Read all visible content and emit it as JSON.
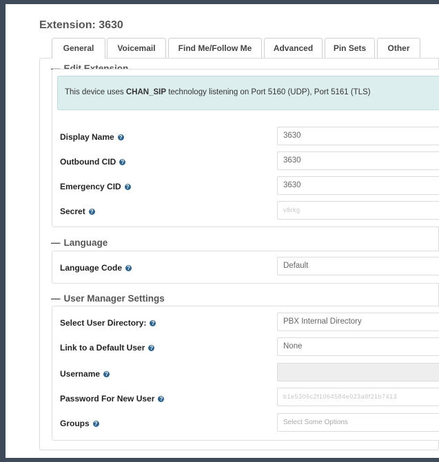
{
  "page": {
    "title": "Extension: 3630"
  },
  "tabs": [
    {
      "label": "General",
      "active": true
    },
    {
      "label": "Voicemail"
    },
    {
      "label": "Find Me/Follow Me"
    },
    {
      "label": "Advanced"
    },
    {
      "label": "Pin Sets"
    },
    {
      "label": "Other"
    }
  ],
  "edit_extension": {
    "title": "Edit Extension",
    "info": {
      "prefix": "This device uses ",
      "tech": "CHAN_SIP",
      "suffix": " technology listening on Port 5160 (UDP), Port 5161 (TLS)"
    },
    "fields": [
      {
        "label": "Display Name",
        "value": "3630"
      },
      {
        "label": "Outbound CID",
        "value": "3630"
      },
      {
        "label": "Emergency CID",
        "value": "3630"
      },
      {
        "label": "Secret",
        "value": "v8rkg"
      }
    ]
  },
  "language": {
    "title": "Language",
    "fields": [
      {
        "label": "Language Code",
        "value": "Default"
      }
    ]
  },
  "user_manager": {
    "title": "User Manager Settings",
    "fields": [
      {
        "label": "Select User Directory:",
        "value": "PBX Internal Directory"
      },
      {
        "label": "Link to a Default User",
        "value": "None"
      },
      {
        "label": "Username",
        "value": ""
      },
      {
        "label": "Password For New User",
        "value": "b1e5306c2f1064584e023a8f21b7413"
      },
      {
        "label": "Groups",
        "placeholder": "Select Some Options"
      }
    ]
  },
  "colors": {
    "accent": "#2a6494",
    "info_bg": "#ddeeee",
    "frame_bg": "#3e4a59"
  }
}
